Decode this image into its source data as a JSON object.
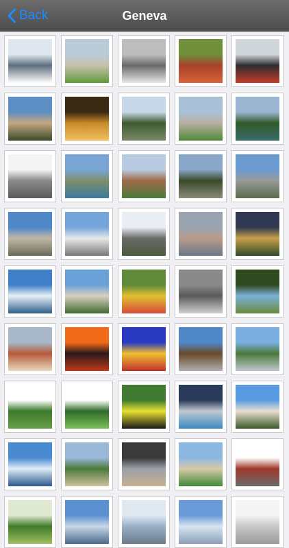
{
  "navbar": {
    "back_label": "Back",
    "title": "Geneva",
    "back_icon": "chevron-left-icon",
    "accent_color": "#1a8cff"
  },
  "gallery": {
    "photos": [
      {
        "name": "frozen-trees",
        "colors": [
          "#dfe6ee",
          "#5f6f7e",
          "#ffffff"
        ]
      },
      {
        "name": "apartment-lawn",
        "colors": [
          "#b9ccd8",
          "#c9c1ac",
          "#5f9a3a"
        ]
      },
      {
        "name": "winter-bw-park",
        "colors": [
          "#bdbdbd",
          "#6a6a6a",
          "#e8e8e8"
        ]
      },
      {
        "name": "autumn-red-leaves",
        "colors": [
          "#6f8f3a",
          "#a8422a",
          "#d8643a"
        ]
      },
      {
        "name": "dark-monument",
        "colors": [
          "#cfd6da",
          "#2d2d2d",
          "#c43b2a"
        ]
      },
      {
        "name": "tall-tower-building",
        "colors": [
          "#5d8fc4",
          "#c4a780",
          "#3a4a2a"
        ]
      },
      {
        "name": "night-street-lights",
        "colors": [
          "#3a2a14",
          "#c98a2a",
          "#f0c060"
        ]
      },
      {
        "name": "large-cedar-tree",
        "colors": [
          "#c8d8e8",
          "#3f5a2f",
          "#7a8a6a"
        ]
      },
      {
        "name": "garden-buildings",
        "colors": [
          "#a9c1d6",
          "#b8b0a0",
          "#4f8a3a"
        ]
      },
      {
        "name": "river-forest",
        "colors": [
          "#9ab6d0",
          "#2f5a2a",
          "#3a6a6a"
        ]
      },
      {
        "name": "concrete-towers",
        "colors": [
          "#f4f4f4",
          "#8a8a8a",
          "#5a5a5a"
        ]
      },
      {
        "name": "river-boats-city",
        "colors": [
          "#7aa6d6",
          "#7d8f6a",
          "#3a7aa0"
        ]
      },
      {
        "name": "small-chapel",
        "colors": [
          "#b8cbe0",
          "#a06a4a",
          "#4a7a3a"
        ]
      },
      {
        "name": "street-trees",
        "colors": [
          "#8aa6c8",
          "#3a4a2a",
          "#8a8a7a"
        ]
      },
      {
        "name": "city-avenue",
        "colors": [
          "#6a9ad0",
          "#9a9a9a",
          "#5a6a4a"
        ]
      },
      {
        "name": "corner-building",
        "colors": [
          "#4f87c9",
          "#c2b7a6",
          "#6a6a5a"
        ]
      },
      {
        "name": "white-apartment-block",
        "colors": [
          "#74a6dc",
          "#e8e8e8",
          "#7a7a7a"
        ]
      },
      {
        "name": "old-church-tower",
        "colors": [
          "#e8eef4",
          "#6a6a6a",
          "#4a5a3a"
        ]
      },
      {
        "name": "city-panorama",
        "colors": [
          "#9aa4b0",
          "#b89a8a",
          "#6a7a8a"
        ]
      },
      {
        "name": "dusk-apartments",
        "colors": [
          "#2f3a52",
          "#c8a04a",
          "#2f4a2a"
        ]
      },
      {
        "name": "jet-deau-lake",
        "colors": [
          "#3f7fc8",
          "#e8f0f8",
          "#2f5f8a"
        ]
      },
      {
        "name": "brunswick-monument",
        "colors": [
          "#6aa0d8",
          "#d8d0c0",
          "#3f6a2f"
        ]
      },
      {
        "name": "yellow-cow-flowers",
        "colors": [
          "#5f8a3a",
          "#e0c030",
          "#d84a3a"
        ]
      },
      {
        "name": "bw-rooftops",
        "colors": [
          "#8a8a8a",
          "#5a5a5a",
          "#d0d0d0"
        ]
      },
      {
        "name": "tree-canopy",
        "colors": [
          "#2f4a1f",
          "#7ab0d8",
          "#6a8a3a"
        ]
      },
      {
        "name": "old-town-roofs",
        "colors": [
          "#a8b8c8",
          "#b85a3a",
          "#e8d8c0"
        ]
      },
      {
        "name": "red-sunset",
        "colors": [
          "#f06a1a",
          "#2a1a1a",
          "#c03a1a"
        ]
      },
      {
        "name": "colored-light-show",
        "colors": [
          "#2a3ac0",
          "#f0c030",
          "#c0302a"
        ]
      },
      {
        "name": "broken-chair",
        "colors": [
          "#4f87c9",
          "#6a4a2a",
          "#b0b0b0"
        ]
      },
      {
        "name": "countryside-field",
        "colors": [
          "#7aaee0",
          "#4a7a3a",
          "#c0c8d0"
        ]
      },
      {
        "name": "green-cedar",
        "colors": [
          "#ffffff",
          "#3a7a2a",
          "#6aa04a"
        ]
      },
      {
        "name": "tree-drawing",
        "colors": [
          "#ffffff",
          "#2f6a2a",
          "#7ac05a"
        ]
      },
      {
        "name": "horse-meadow",
        "colors": [
          "#3f7a2f",
          "#e8e030",
          "#1a1a1a"
        ]
      },
      {
        "name": "modern-pool-building",
        "colors": [
          "#2a3a5a",
          "#c0c8d0",
          "#3a8ac0"
        ]
      },
      {
        "name": "villa-house",
        "colors": [
          "#5a9ae0",
          "#e8e0d0",
          "#3a5a2a"
        ]
      },
      {
        "name": "fountain-harbor",
        "colors": [
          "#4a8ad0",
          "#e0ecf8",
          "#2a5a8a"
        ]
      },
      {
        "name": "park-lawn",
        "colors": [
          "#9ab8d8",
          "#4a7a3a",
          "#d0c0a0"
        ]
      },
      {
        "name": "rainbow-street",
        "colors": [
          "#3a3a3a",
          "#9aa0a8",
          "#c8b090"
        ]
      },
      {
        "name": "palace-lawn",
        "colors": [
          "#8ab8e0",
          "#d8c8a8",
          "#3f8a3a"
        ]
      },
      {
        "name": "red-hut-snow",
        "colors": [
          "#ffffff",
          "#a03a2a",
          "#6a6a6a"
        ]
      },
      {
        "name": "green-trees-partial",
        "colors": [
          "#dfe8d0",
          "#3f7a2a",
          "#a0c060"
        ]
      },
      {
        "name": "blue-sky-partial",
        "colors": [
          "#5a90d0",
          "#c8d8e8",
          "#4a6a8a"
        ]
      },
      {
        "name": "fountain-partial",
        "colors": [
          "#e0e8f0",
          "#9ab0c8",
          "#6a7a8a"
        ]
      },
      {
        "name": "sky-partial",
        "colors": [
          "#6a9ad8",
          "#d8e4f0",
          "#8aa0b8"
        ]
      },
      {
        "name": "white-partial",
        "colors": [
          "#f4f4f4",
          "#c8c8c8",
          "#9a9a9a"
        ]
      }
    ]
  }
}
